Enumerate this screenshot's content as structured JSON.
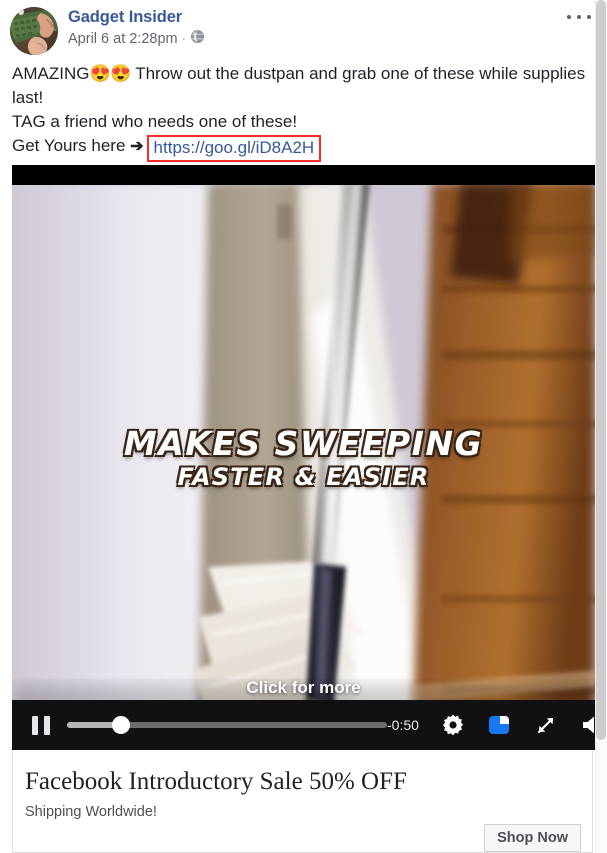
{
  "post": {
    "author": "Gadget Insider",
    "timestamp": "April 6 at 2:28pm",
    "separator": "·",
    "privacy_icon": "globe-icon",
    "more_icon": "ellipsis-icon",
    "avatar_alt": "hands-on-keyboard-avatar",
    "body": {
      "line1_a": "AMAZING",
      "line1_emoji": "😍😍",
      "line1_b": " Throw out the dustpan and grab one of these while supplies last!",
      "line2": "TAG a friend who needs one of these!",
      "line3_prefix": "Get Yours here ",
      "line3_arrow": "➔",
      "link_text": "https://goo.gl/iD8A2H",
      "link_box_color": "#fc2b27"
    }
  },
  "video": {
    "overlay_line1": "MAKES SWEEPING",
    "overlay_line2": "FASTER & EASIER",
    "click_prompt": "Click for more",
    "controls": {
      "play_pause_icon": "pause-icon",
      "time_remaining": "-0:50",
      "settings_icon": "gear-icon",
      "pip_icon": "picture-in-picture-icon",
      "fullscreen_icon": "expand-icon",
      "volume_icon": "volume-on-icon",
      "progress_percent": 17,
      "buffered_percent": 100,
      "pip_accent_color": "#1877f2"
    }
  },
  "link_card": {
    "title": "Facebook Introductory Sale 50% OFF",
    "subtitle": "Shipping Worldwide!",
    "cta_label": "Shop Now"
  }
}
